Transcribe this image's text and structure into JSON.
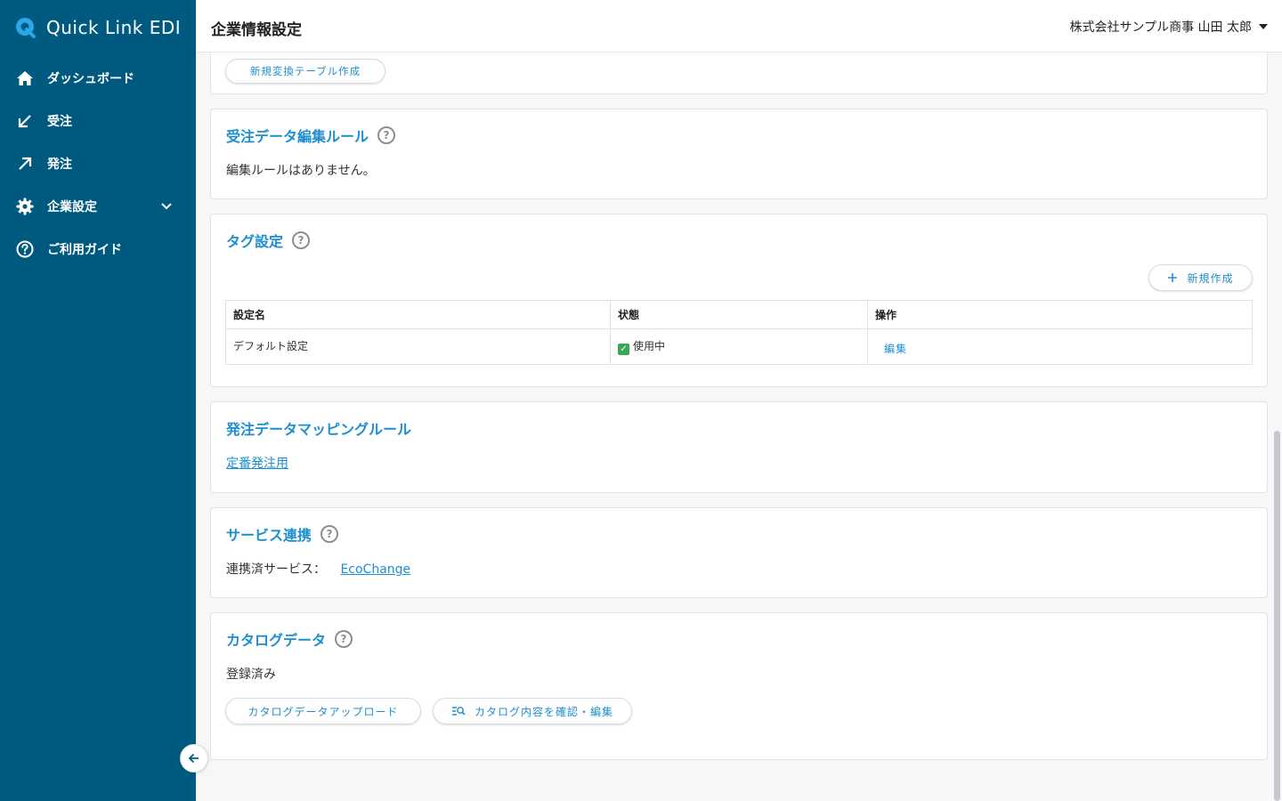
{
  "app": {
    "name": "Quick Link EDI"
  },
  "sidebar": {
    "items": [
      {
        "label": "ダッシュボード",
        "icon": "home-icon"
      },
      {
        "label": "受注",
        "icon": "arrow-down-left-icon"
      },
      {
        "label": "発注",
        "icon": "arrow-up-right-icon"
      },
      {
        "label": "企業設定",
        "icon": "gear-icon",
        "expandable": true
      },
      {
        "label": "ご利用ガイド",
        "icon": "help-circle-icon"
      }
    ]
  },
  "header": {
    "title": "企業情報設定",
    "user": "株式会社サンプル商事 山田 太郎"
  },
  "sections": {
    "conversion": {
      "button_label": "新規変換テーブル作成"
    },
    "edit_rules": {
      "title": "受注データ編集ルール",
      "help": "?",
      "text": "編集ルールはありません。"
    },
    "tags": {
      "title": "タグ設定",
      "help": "?",
      "new_button": "新規作成",
      "columns": [
        "設定名",
        "状態",
        "操作"
      ],
      "rows": [
        {
          "name": "デフォルト設定",
          "status": "使用中",
          "action": "編集"
        }
      ]
    },
    "mapping": {
      "title": "発注データマッピングルール",
      "link": "定番発注用"
    },
    "service": {
      "title": "サービス連携",
      "help": "?",
      "label": "連携済サービス：",
      "link": "EcoChange"
    },
    "catalog": {
      "title": "カタログデータ",
      "help": "?",
      "status": "登録済み",
      "upload_button": "カタログデータアップロード",
      "view_button": "カタログ内容を確認・編集"
    }
  },
  "colors": {
    "sidebar": "#005a80",
    "accent": "#1d8fcf",
    "status_ok": "#3aa757"
  }
}
